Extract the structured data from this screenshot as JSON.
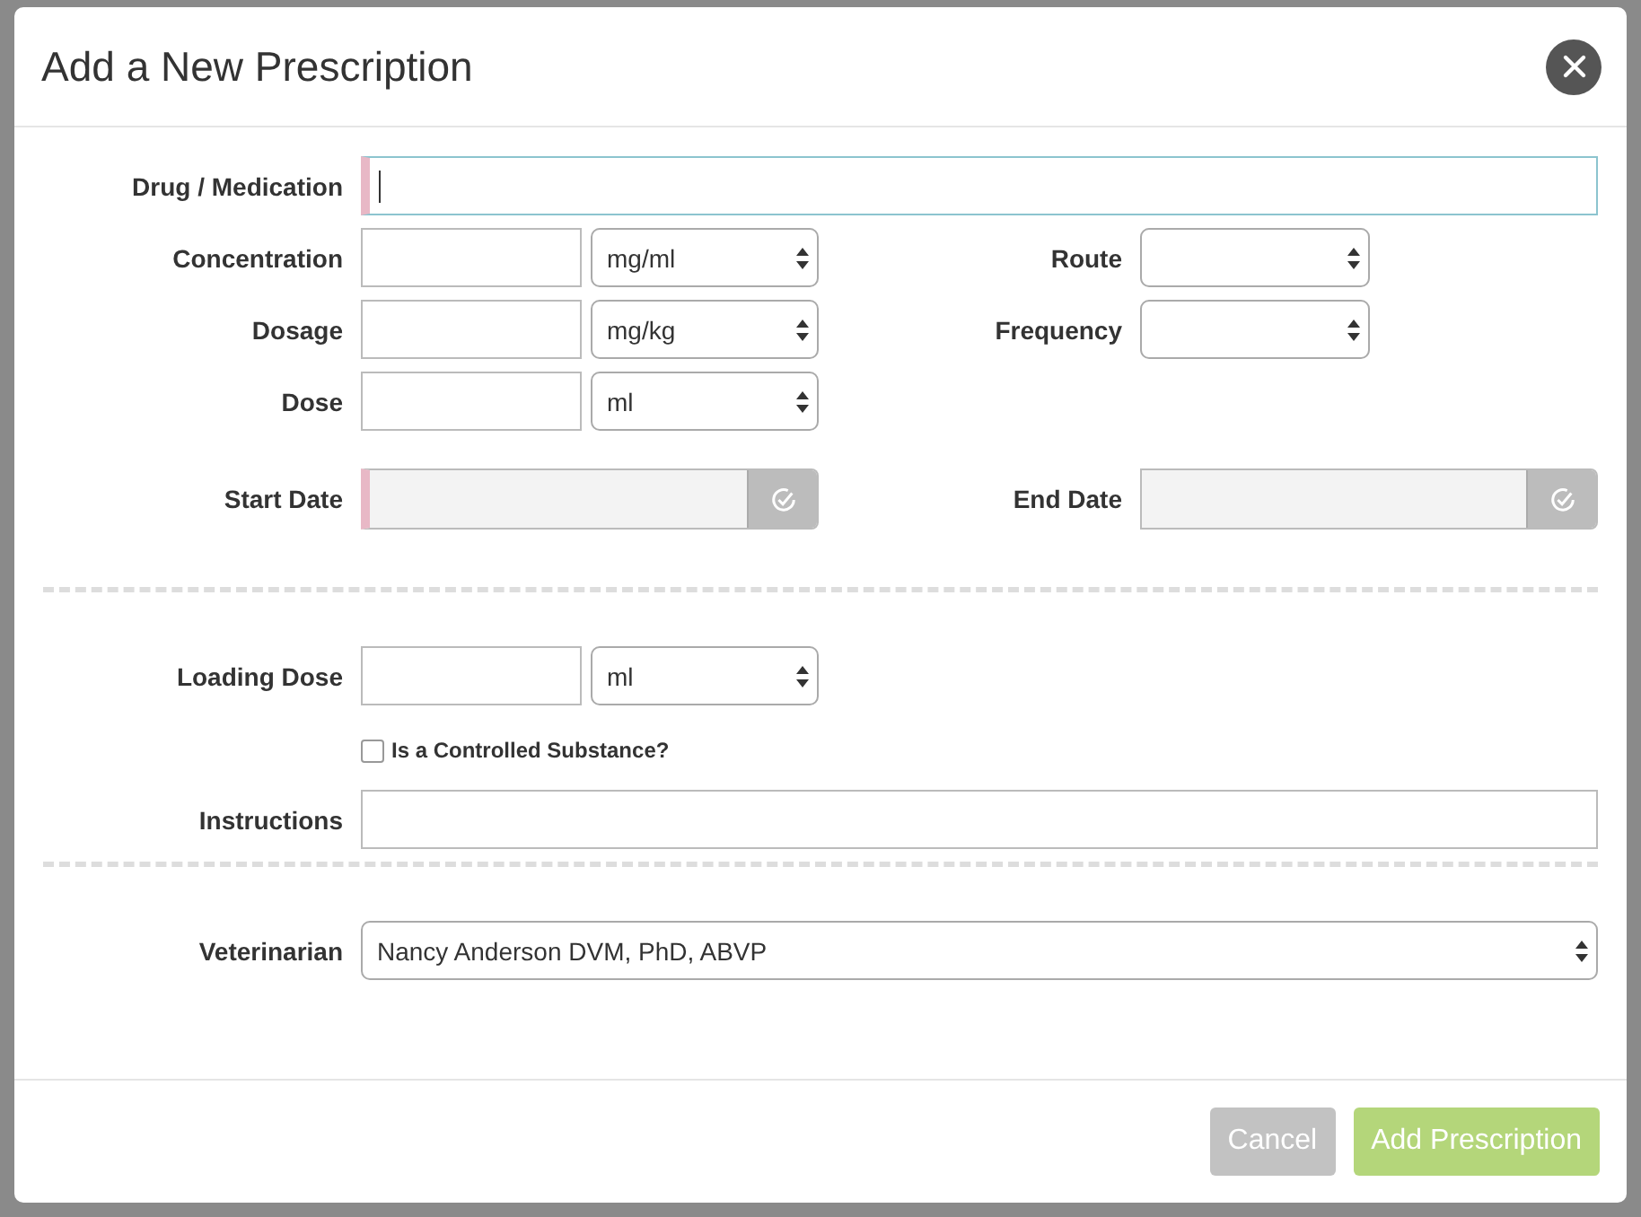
{
  "dialog": {
    "title": "Add a New Prescription"
  },
  "drug": {
    "label": "Drug / Medication",
    "required": true,
    "focused": true
  },
  "dose_rows": [
    {
      "label": "Concentration",
      "unit": "mg/ml",
      "side": {
        "label": "Route"
      }
    },
    {
      "label": "Dosage",
      "unit": "mg/kg",
      "side": {
        "label": "Frequency"
      }
    },
    {
      "label": "Dose",
      "unit": "ml"
    }
  ],
  "dates": [
    {
      "label": "Start Date",
      "required": true
    },
    {
      "label": "End Date",
      "required": false
    }
  ],
  "loading_dose": {
    "label": "Loading Dose",
    "unit": "ml"
  },
  "controlled": {
    "label": "Is a Controlled Substance?",
    "checked": false
  },
  "instructions": {
    "label": "Instructions"
  },
  "veterinarian": {
    "label": "Veterinarian",
    "value": "Nancy Anderson DVM, PhD, ABVP"
  },
  "buttons": [
    {
      "label": "Cancel",
      "kind": "secondary"
    },
    {
      "label": "Add Prescription",
      "kind": "primary"
    }
  ]
}
